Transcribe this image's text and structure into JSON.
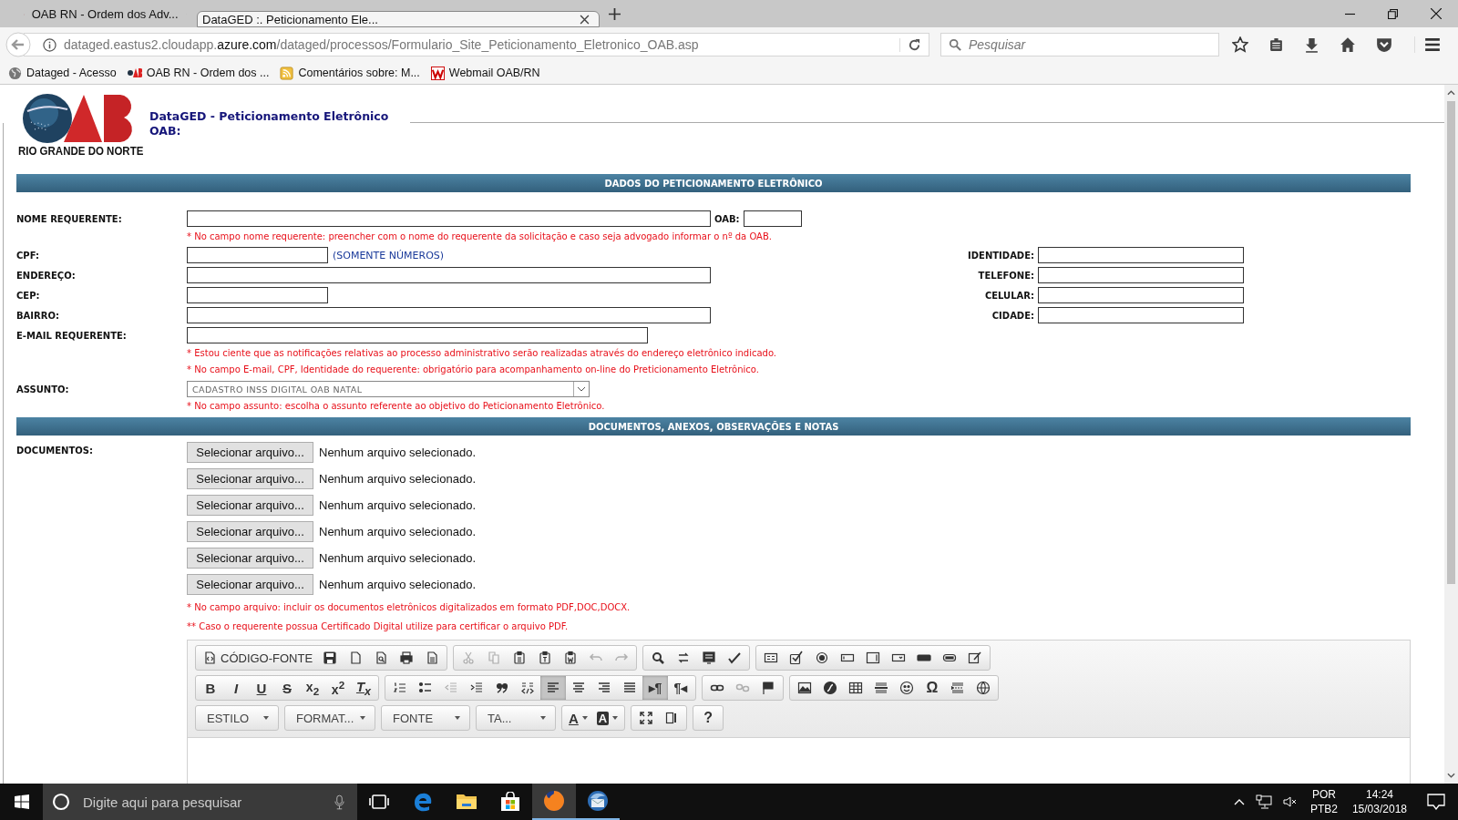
{
  "browser": {
    "tabs": [
      {
        "title": "OAB RN - Ordem dos Adv...",
        "selected": false,
        "kind": "oab"
      },
      {
        "title": "DataGED :. Peticionamento Ele...",
        "selected": true,
        "kind": "none"
      }
    ],
    "url": "dataged.eastus2.cloudapp.**azure.com**/dataged/processos/Formulario_Site_Peticionamento_Eletronico_OAB.asp",
    "search_placeholder": "Pesquisar",
    "bookmarks": [
      {
        "title": "Dataged - Acesso",
        "kind": "globe"
      },
      {
        "title": "OAB RN - Ordem dos ...",
        "kind": "oab"
      },
      {
        "title": "Comentários sobre: M...",
        "kind": "feed"
      },
      {
        "title": "Webmail OAB/RN",
        "kind": "webmail"
      }
    ]
  },
  "header": {
    "logo_caption": "RIO GRANDE DO NORTE",
    "title": "DataGED - Peticionamento Eletrônico",
    "subtitle": "OAB:"
  },
  "form": {
    "section_title": "DADOS DO PETICIONAMENTO ELETRÔNICO",
    "name": {
      "label": "NOME REQUERENTE:",
      "oab_label": "OAB:",
      "note": "* No campo nome requerente: preencher com o nome do requerente da solicitação e caso seja advogado informar o nº da OAB."
    },
    "cpf": {
      "label": "CPF:",
      "hint": "(SOMENTE NÚMEROS)"
    },
    "identity": {
      "label": "IDENTIDADE:"
    },
    "address": {
      "label": "ENDEREÇO:"
    },
    "phone": {
      "label": "TELEFONE:"
    },
    "cep": {
      "label": "CEP:"
    },
    "mobile": {
      "label": "CELULAR:"
    },
    "district": {
      "label": "BAIRRO:"
    },
    "city": {
      "label": "CIDADE:"
    },
    "email": {
      "label": "E-MAIL REQUERENTE:",
      "notes": [
        "* Estou ciente que as notificações relativas ao processo administrativo serão realizadas através do endereço eletrônico indicado.",
        "* No campo E-mail, CPF, Identidade do requerente: obrigatório para acompanhamento on-line do Preticionamento Eletrônico."
      ]
    },
    "subject": {
      "label": "ASSUNTO:",
      "value": "CADASTRO INSS DIGITAL OAB NATAL",
      "note": "* No campo assunto: escolha o assunto referente ao objetivo do Peticionamento Eletrônico."
    }
  },
  "documents": {
    "section_title": "DOCUMENTOS, ANEXOS, OBSERVAÇÕES E NOTAS",
    "label": "DOCUMENTOS:",
    "files": [
      {
        "button": "Selecionar arquivo...",
        "status": "Nenhum arquivo selecionado."
      },
      {
        "button": "Selecionar arquivo...",
        "status": "Nenhum arquivo selecionado."
      },
      {
        "button": "Selecionar arquivo...",
        "status": "Nenhum arquivo selecionado."
      },
      {
        "button": "Selecionar arquivo...",
        "status": "Nenhum arquivo selecionado."
      },
      {
        "button": "Selecionar arquivo...",
        "status": "Nenhum arquivo selecionado."
      },
      {
        "button": "Selecionar arquivo...",
        "status": "Nenhum arquivo selecionado."
      }
    ],
    "notes": [
      "* No campo arquivo: incluir os documentos eletrônicos digitalizados em formato PDF,DOC,DOCX.",
      "** Caso o requerente possua Certificado Digital utilize para certificar o arquivo PDF."
    ]
  },
  "editor": {
    "rows": [
      [
        [
          {
            "kind": "source",
            "label": "CÓDIGO-FONTE",
            "on": false,
            "disabled": false
          },
          {
            "kind": "save",
            "on": false,
            "disabled": false
          },
          {
            "kind": "newpage",
            "on": false,
            "disabled": false
          },
          {
            "kind": "preview",
            "on": false,
            "disabled": false
          },
          {
            "kind": "print",
            "on": false,
            "disabled": false
          },
          {
            "kind": "templates",
            "on": false,
            "disabled": false
          }
        ],
        [
          {
            "kind": "cut",
            "on": false,
            "disabled": true
          },
          {
            "kind": "copy",
            "on": false,
            "disabled": true
          },
          {
            "kind": "paste",
            "on": false,
            "disabled": false
          },
          {
            "kind": "pastetext",
            "on": false,
            "disabled": false
          },
          {
            "kind": "pasteword",
            "on": false,
            "disabled": false
          },
          {
            "kind": "undo",
            "on": false,
            "disabled": true
          },
          {
            "kind": "redo",
            "on": false,
            "disabled": true
          }
        ],
        [
          {
            "kind": "find",
            "on": false,
            "disabled": false
          },
          {
            "kind": "replace",
            "on": false,
            "disabled": false
          },
          {
            "kind": "selectall",
            "on": false,
            "disabled": false
          },
          {
            "kind": "spellcheck",
            "on": false,
            "disabled": false
          }
        ],
        [
          {
            "kind": "form",
            "on": false,
            "disabled": false
          },
          {
            "kind": "checkbox",
            "on": false,
            "disabled": false
          },
          {
            "kind": "radio",
            "on": false,
            "disabled": false
          },
          {
            "kind": "textfield",
            "on": false,
            "disabled": false
          },
          {
            "kind": "textarea",
            "on": false,
            "disabled": false
          },
          {
            "kind": "select",
            "on": false,
            "disabled": false
          },
          {
            "kind": "button",
            "on": false,
            "disabled": false
          },
          {
            "kind": "imagebutton",
            "on": false,
            "disabled": false
          },
          {
            "kind": "hidden",
            "on": false,
            "disabled": false
          }
        ]
      ],
      [
        [
          {
            "kind": "bold",
            "label": "B",
            "on": false,
            "disabled": false
          },
          {
            "kind": "italic",
            "label": "I",
            "on": false,
            "disabled": false
          },
          {
            "kind": "underline",
            "label": "U",
            "on": false,
            "disabled": false
          },
          {
            "kind": "strike",
            "label": "S",
            "on": false,
            "disabled": false
          },
          {
            "kind": "subscript",
            "label": "x$_{2}$",
            "on": false,
            "disabled": false
          },
          {
            "kind": "superscript",
            "label": "x$^{2}$",
            "on": false,
            "disabled": false
          },
          {
            "kind": "removeformat",
            "label": "T$_{x}$",
            "on": false,
            "disabled": false
          }
        ],
        [
          {
            "kind": "numbered",
            "on": false,
            "disabled": false
          },
          {
            "kind": "bulleted",
            "on": false,
            "disabled": false
          },
          {
            "kind": "outdent",
            "on": false,
            "disabled": true
          },
          {
            "kind": "indent",
            "on": false,
            "disabled": false
          },
          {
            "kind": "blockquote",
            "on": false,
            "disabled": false
          },
          {
            "kind": "div",
            "on": false,
            "disabled": false
          },
          {
            "kind": "alignleft",
            "on": true,
            "disabled": false
          },
          {
            "kind": "aligncenter",
            "on": false,
            "disabled": false
          },
          {
            "kind": "alignright",
            "on": false,
            "disabled": false
          },
          {
            "kind": "justify",
            "on": false,
            "disabled": false
          },
          {
            "kind": "ltr",
            "label": "▸¶",
            "on": true,
            "disabled": false
          },
          {
            "kind": "rtl",
            "label": "¶◂",
            "on": false,
            "disabled": false
          }
        ],
        [
          {
            "kind": "link",
            "on": false,
            "disabled": false
          },
          {
            "kind": "unlink",
            "on": false,
            "disabled": true
          },
          {
            "kind": "anchor",
            "on": false,
            "disabled": false
          }
        ],
        [
          {
            "kind": "image",
            "on": false,
            "disabled": false
          },
          {
            "kind": "flash",
            "on": false,
            "disabled": false
          },
          {
            "kind": "table",
            "on": false,
            "disabled": false
          },
          {
            "kind": "hr",
            "on": false,
            "disabled": false
          },
          {
            "kind": "smiley",
            "on": false,
            "disabled": false
          },
          {
            "kind": "specialchar",
            "label": "Ω",
            "on": false,
            "disabled": false
          },
          {
            "kind": "pagebreak",
            "on": false,
            "disabled": false
          },
          {
            "kind": "iframe",
            "on": false,
            "disabled": false
          }
        ]
      ],
      [
        [
          {
            "kind": "combo",
            "label": "ESTILO",
            "on": false,
            "disabled": false
          }
        ],
        [
          {
            "kind": "combo",
            "label": "FORMAT...",
            "on": false,
            "disabled": false
          }
        ],
        [
          {
            "kind": "combo",
            "label": "FONTE",
            "on": false,
            "disabled": false
          }
        ],
        [
          {
            "kind": "combo",
            "label": "TA...",
            "on": false,
            "disabled": false
          }
        ],
        [
          {
            "kind": "textcolor",
            "label": "A",
            "on": false,
            "disabled": false
          },
          {
            "kind": "bgcolor",
            "label": "A",
            "on": false,
            "disabled": false
          }
        ],
        [
          {
            "kind": "maximize",
            "on": false,
            "disabled": false
          },
          {
            "kind": "showblocks",
            "on": false,
            "disabled": false
          }
        ],
        [
          {
            "kind": "about",
            "label": "?",
            "on": false,
            "disabled": false
          }
        ]
      ]
    ]
  },
  "taskbar": {
    "search_placeholder": "Digite aqui para pesquisar",
    "apps": [
      {
        "kind": "taskview",
        "running": false,
        "active": false
      },
      {
        "kind": "edge",
        "running": false,
        "active": false
      },
      {
        "kind": "explorer",
        "running": false,
        "active": false
      },
      {
        "kind": "store",
        "running": false,
        "active": false
      },
      {
        "kind": "firefox",
        "running": true,
        "active": true
      },
      {
        "kind": "thunderbird",
        "running": true,
        "active": false
      }
    ],
    "language": "POR",
    "layout": "PTB2",
    "time": "14:24",
    "date": "15/03/2018"
  }
}
